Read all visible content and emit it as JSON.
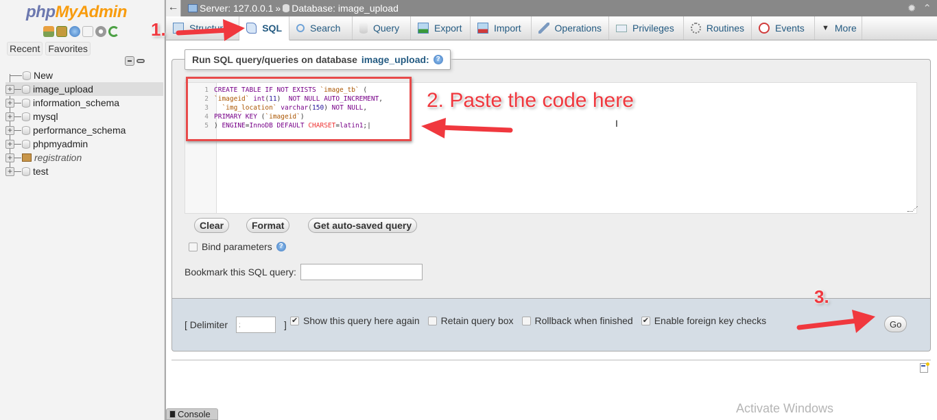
{
  "sidebar": {
    "logo": {
      "php": "php",
      "myadmin": "MyAdmin"
    },
    "nav_icons": [
      "home-icon",
      "logout-icon",
      "help-icon",
      "docs-icon",
      "settings-icon",
      "reload-icon"
    ],
    "buttons": {
      "recent": "Recent",
      "favorites": "Favorites"
    },
    "tree": [
      {
        "label": "New",
        "type": "new"
      },
      {
        "label": "image_upload",
        "type": "db",
        "selected": true
      },
      {
        "label": "information_schema",
        "type": "db"
      },
      {
        "label": "mysql",
        "type": "db"
      },
      {
        "label": "performance_schema",
        "type": "db"
      },
      {
        "label": "phpmyadmin",
        "type": "db"
      },
      {
        "label": "registration",
        "type": "db-italic"
      },
      {
        "label": "test",
        "type": "db"
      }
    ]
  },
  "topbar": {
    "back": "←",
    "server": "Server: 127.0.0.1",
    "separator": "»",
    "database": "Database: image_upload"
  },
  "tabs": [
    {
      "label": "Structure",
      "icon": "structure-icon"
    },
    {
      "label": "SQL",
      "icon": "sql-icon",
      "active": true
    },
    {
      "label": "Search",
      "icon": "search-icon"
    },
    {
      "label": "Query",
      "icon": "query-icon"
    },
    {
      "label": "Export",
      "icon": "export-icon"
    },
    {
      "label": "Import",
      "icon": "import-icon"
    },
    {
      "label": "Operations",
      "icon": "wrench-icon"
    },
    {
      "label": "Privileges",
      "icon": "privileges-icon"
    },
    {
      "label": "Routines",
      "icon": "routines-icon"
    },
    {
      "label": "Events",
      "icon": "clock-icon"
    },
    {
      "label": "More",
      "icon": "chevron-down-icon"
    }
  ],
  "sql_panel": {
    "legend_prefix": "Run SQL query/queries on database",
    "legend_db": "image_upload:",
    "code_lines": [
      "CREATE TABLE IF NOT EXISTS `image_tb` (",
      "`imageid` int(11)  NOT NULL AUTO_INCREMENT,",
      "  `img_location` varchar(150) NOT NULL,",
      "PRIMARY KEY (`imageid`)",
      ") ENGINE=InnoDB DEFAULT CHARSET=latin1;"
    ],
    "buttons": {
      "clear": "Clear",
      "format": "Format",
      "autosaved": "Get auto-saved query"
    },
    "bind_parameters": {
      "label": "Bind parameters",
      "checked": false
    },
    "bookmark_label": "Bookmark this SQL query:",
    "bookmark_value": ""
  },
  "footer": {
    "delimiter_open": "[ Delimiter",
    "delimiter_value": ";",
    "delimiter_close": "]",
    "options": [
      {
        "label": "Show this query here again",
        "checked": true
      },
      {
        "label": "Retain query box",
        "checked": false
      },
      {
        "label": "Rollback when finished",
        "checked": false
      },
      {
        "label": "Enable foreign key checks",
        "checked": true
      }
    ],
    "go": "Go"
  },
  "console": {
    "label": "Console"
  },
  "watermark": "Activate Windows",
  "annotations": {
    "step1": "1.",
    "step2": "2. Paste the  code here",
    "step3": "3.",
    "color": "#f0383e"
  }
}
